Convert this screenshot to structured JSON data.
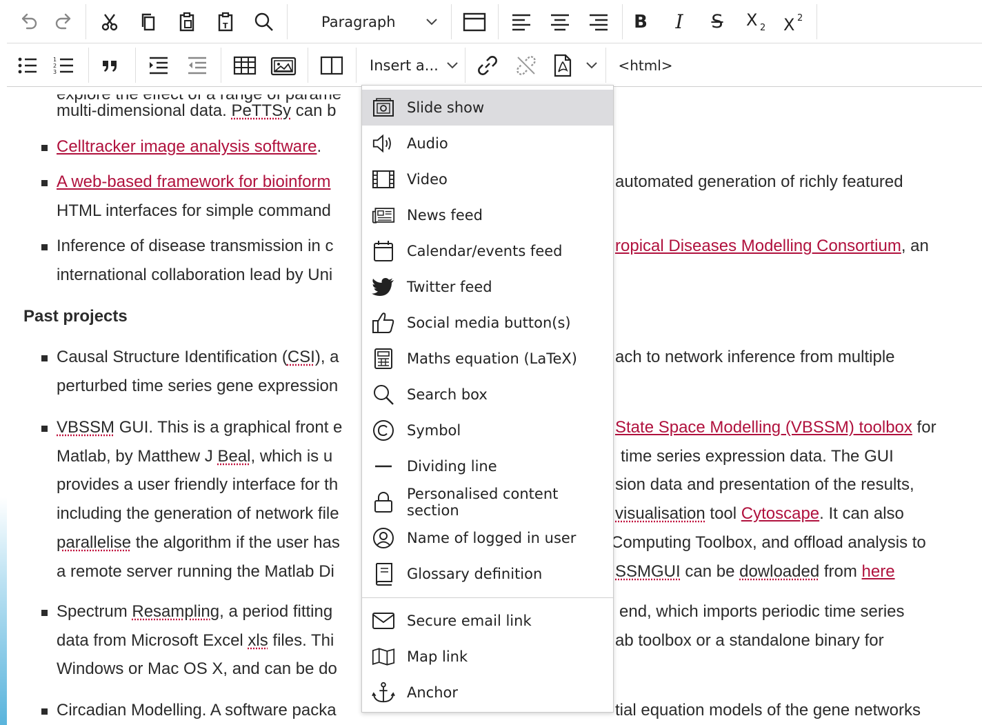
{
  "toolbar": {
    "format_select": "Paragraph",
    "insert_select": "Insert a...",
    "html_label": "<html>",
    "bold_label": "B",
    "italic_label": "I",
    "strike_label": "S"
  },
  "content": {
    "l1": "multi-dimensional data. ",
    "l1_sp": "PeTTSy",
    "l1_rest": " can b",
    "b1_link": "Celltracker image analysis software",
    "b1_tail": ".",
    "b2_link": "A web-based framework for bioinform",
    "b2_right": "automated generation of richly featured",
    "b2_l2": "HTML interfaces for simple command",
    "b3_left": "Inference of disease transmission in c",
    "b3_right_link": "ropical Diseases Modelling Consortium",
    "b3_right_tail": ", an",
    "b3_l2": "international collaboration lead by Uni",
    "heading": "Past projects",
    "c1_a": "Causal Structure Identification (",
    "c1_sp": "CSI",
    "c1_b": "), a",
    "c1_right": "ach to network inference from multiple",
    "c1_l2": "perturbed time series gene expression",
    "c2_sp": "VBSSM",
    "c2_a": " GUI. This is a graphical front e",
    "c2_right_link": "State Space Modelling (VBSSM) toolbox",
    "c2_right_tail": " for",
    "c2_l2a": "Matlab, by Matthew J ",
    "c2_l2sp": "Beal",
    "c2_l2b": ", which is u",
    "c2_l2_right": "time series expression data. The GUI",
    "c2_l3": "provides a user friendly interface for th",
    "c2_l3_right": "sion data and presentation of the results,",
    "c2_l4": "including the generation of network file",
    "c2_l4_right_sp": "visualisation",
    "c2_l4_right_a": " tool ",
    "c2_l4_right_link": "Cytoscape",
    "c2_l4_right_b": ". It can also",
    "c2_l5_sp": "parallelise",
    "c2_l5": " the algorithm if the user has",
    "c2_l5_right": "Computing Toolbox, and offload analysis to",
    "c2_l6": "a remote server running the Matlab Di",
    "c2_l6_right_sp": "SSMGUI",
    "c2_l6_right_a": " can be ",
    "c2_l6_right_sp2": "dowloaded",
    "c2_l6_right_b": " from ",
    "c2_l6_right_link": "here",
    "c3_a": "Spectrum ",
    "c3_sp": "Resampling",
    "c3_b": ", a period fitting",
    "c3_right": "end, which imports periodic time series",
    "c3_l2a": "data from Microsoft Excel ",
    "c3_l2sp": "xls",
    "c3_l2b": " files. Thi",
    "c3_l2_right": "ab toolbox or a standalone binary for",
    "c3_l3": "Windows or Mac OS X, and can be do",
    "c4_a": "Circadian Modelling. A software packa",
    "c4_right": "tial equation models of the gene networks"
  },
  "menu": {
    "items": [
      {
        "label": "Slide show",
        "icon": "slideshow-icon"
      },
      {
        "label": "Audio",
        "icon": "audio-icon"
      },
      {
        "label": "Video",
        "icon": "video-icon"
      },
      {
        "label": "News feed",
        "icon": "newsfeed-icon"
      },
      {
        "label": "Calendar/events feed",
        "icon": "calendar-icon"
      },
      {
        "label": "Twitter feed",
        "icon": "twitter-icon"
      },
      {
        "label": "Social media button(s)",
        "icon": "thumbs-up-icon"
      },
      {
        "label": "Maths equation (LaTeX)",
        "icon": "calculator-icon"
      },
      {
        "label": "Search box",
        "icon": "search-icon"
      },
      {
        "label": "Symbol",
        "icon": "copyright-icon"
      },
      {
        "label": "Dividing line",
        "icon": "horizontal-line-icon"
      },
      {
        "label": "Personalised content section",
        "icon": "lock-icon"
      },
      {
        "label": "Name of logged in user",
        "icon": "user-icon"
      },
      {
        "label": "Glossary definition",
        "icon": "book-icon"
      },
      {
        "label": "Secure email link",
        "icon": "envelope-icon"
      },
      {
        "label": "Map link",
        "icon": "map-icon"
      },
      {
        "label": "Anchor",
        "icon": "anchor-icon"
      }
    ]
  }
}
